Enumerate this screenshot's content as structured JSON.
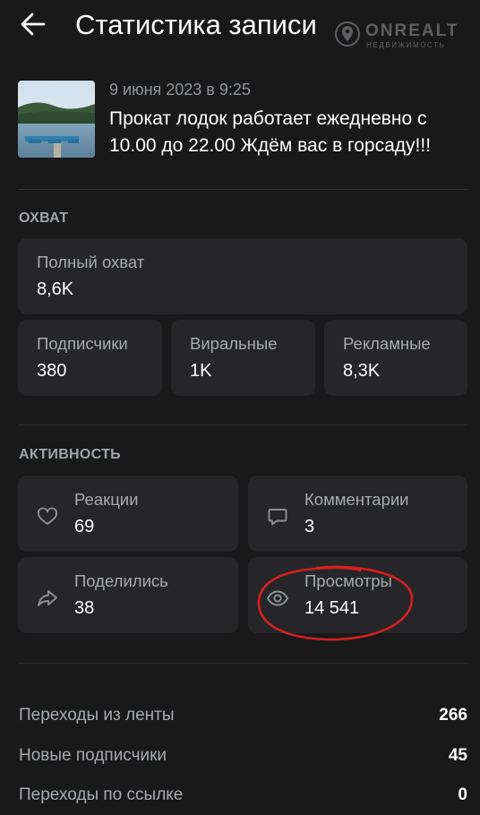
{
  "header": {
    "title": "Статистика записи"
  },
  "watermark": {
    "brand": "ONREALT",
    "tagline": "НЕДВИЖИМОСТЬ"
  },
  "post": {
    "date": "9 июня 2023 в 9:25",
    "text": "Прокат лодок работает ежедневно с 10.00 до 22.00 Ждём вас в горсаду!!!"
  },
  "reach": {
    "section_label": "ОХВАТ",
    "total": {
      "label": "Полный охват",
      "value": "8,6K"
    },
    "subscribers": {
      "label": "Подписчики",
      "value": "380"
    },
    "viral": {
      "label": "Виральные",
      "value": "1K"
    },
    "ads": {
      "label": "Рекламные",
      "value": "8,3K"
    }
  },
  "activity": {
    "section_label": "АКТИВНОСТЬ",
    "reactions": {
      "label": "Реакции",
      "value": "69",
      "icon": "heart-icon"
    },
    "comments": {
      "label": "Комментарии",
      "value": "3",
      "icon": "comment-icon"
    },
    "shares": {
      "label": "Поделились",
      "value": "38",
      "icon": "share-icon"
    },
    "views": {
      "label": "Просмотры",
      "value": "14 541",
      "icon": "eye-icon"
    }
  },
  "stats": [
    {
      "label": "Переходы из ленты",
      "value": "266"
    },
    {
      "label": "Новые подписчики",
      "value": "45"
    },
    {
      "label": "Переходы по ссылке",
      "value": "0"
    }
  ],
  "colors": {
    "background": "#19191a",
    "card": "#262628",
    "text_primary": "#ffffff",
    "text_secondary": "#a7aaae",
    "annotation": "#d42020"
  }
}
